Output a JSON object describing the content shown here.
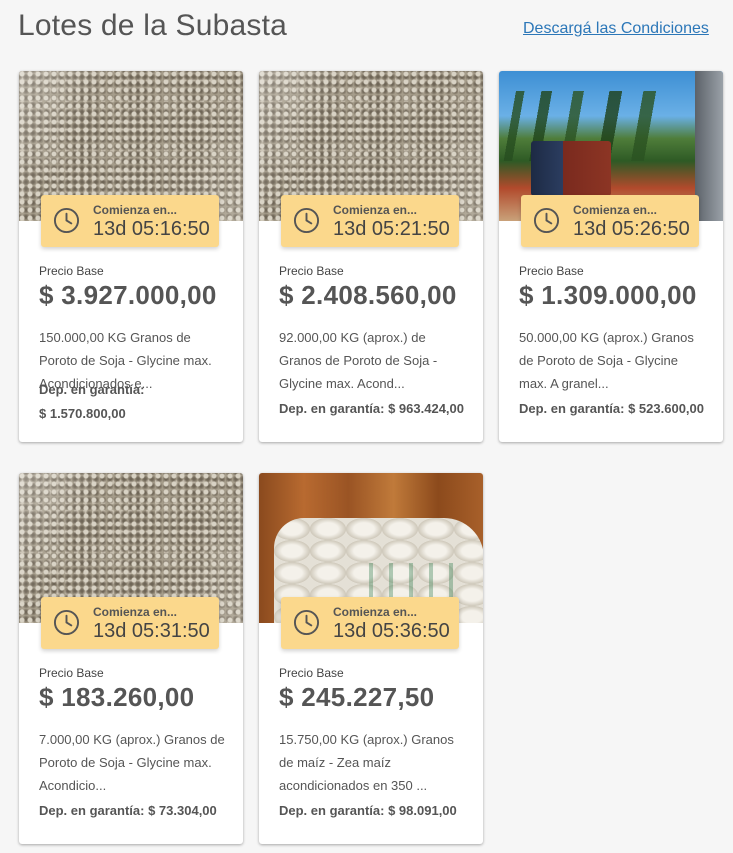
{
  "header": {
    "title": "Lotes de la Subasta",
    "download_link": "Descargá las Condiciones"
  },
  "lots": [
    {
      "image": "soy-beans",
      "timer_label": "Comienza en...",
      "timer_value": "13d 05:16:50",
      "price_label": "Precio Base",
      "price": "$ 3.927.000,00",
      "description": "150.000,00 KG Granos de Poroto de Soja - Glycine max. Acondicionados e...",
      "deposit_label": "Dep. en garantía:",
      "deposit_value": "$ 1.570.800,00"
    },
    {
      "image": "soy-beans",
      "timer_label": "Comienza en...",
      "timer_value": "13d 05:21:50",
      "price_label": "Precio Base",
      "price": "$ 2.408.560,00",
      "description": "92.000,00 KG (aprox.) de Granos de Poroto de Soja - Glycine max. Acond...",
      "deposit_label": "Dep. en garantía:",
      "deposit_value": "$ 963.424,00"
    },
    {
      "image": "truck-forest",
      "timer_label": "Comienza en...",
      "timer_value": "13d 05:26:50",
      "price_label": "Precio Base",
      "price": "$ 1.309.000,00",
      "description": "50.000,00 KG (aprox.) Granos de Poroto de Soja - Glycine max. A granel...",
      "deposit_label": "Dep. en garantía:",
      "deposit_value": "$ 523.600,00"
    },
    {
      "image": "soy-beans",
      "timer_label": "Comienza en...",
      "timer_value": "13d 05:31:50",
      "price_label": "Precio Base",
      "price": "$ 183.260,00",
      "description": "7.000,00 KG (aprox.) Granos de Poroto de Soja - Glycine max. Acondicio...",
      "deposit_label": "Dep. en garantía:",
      "deposit_value": "$ 73.304,00"
    },
    {
      "image": "corn-bags",
      "timer_label": "Comienza en...",
      "timer_value": "13d 05:36:50",
      "price_label": "Precio Base",
      "price": "$ 245.227,50",
      "description": "15.750,00 KG (aprox.) Granos de maíz - Zea maíz acondicionados en 350 ...",
      "deposit_label": "Dep. en garantía:",
      "deposit_value": "$ 98.091,00"
    }
  ]
}
